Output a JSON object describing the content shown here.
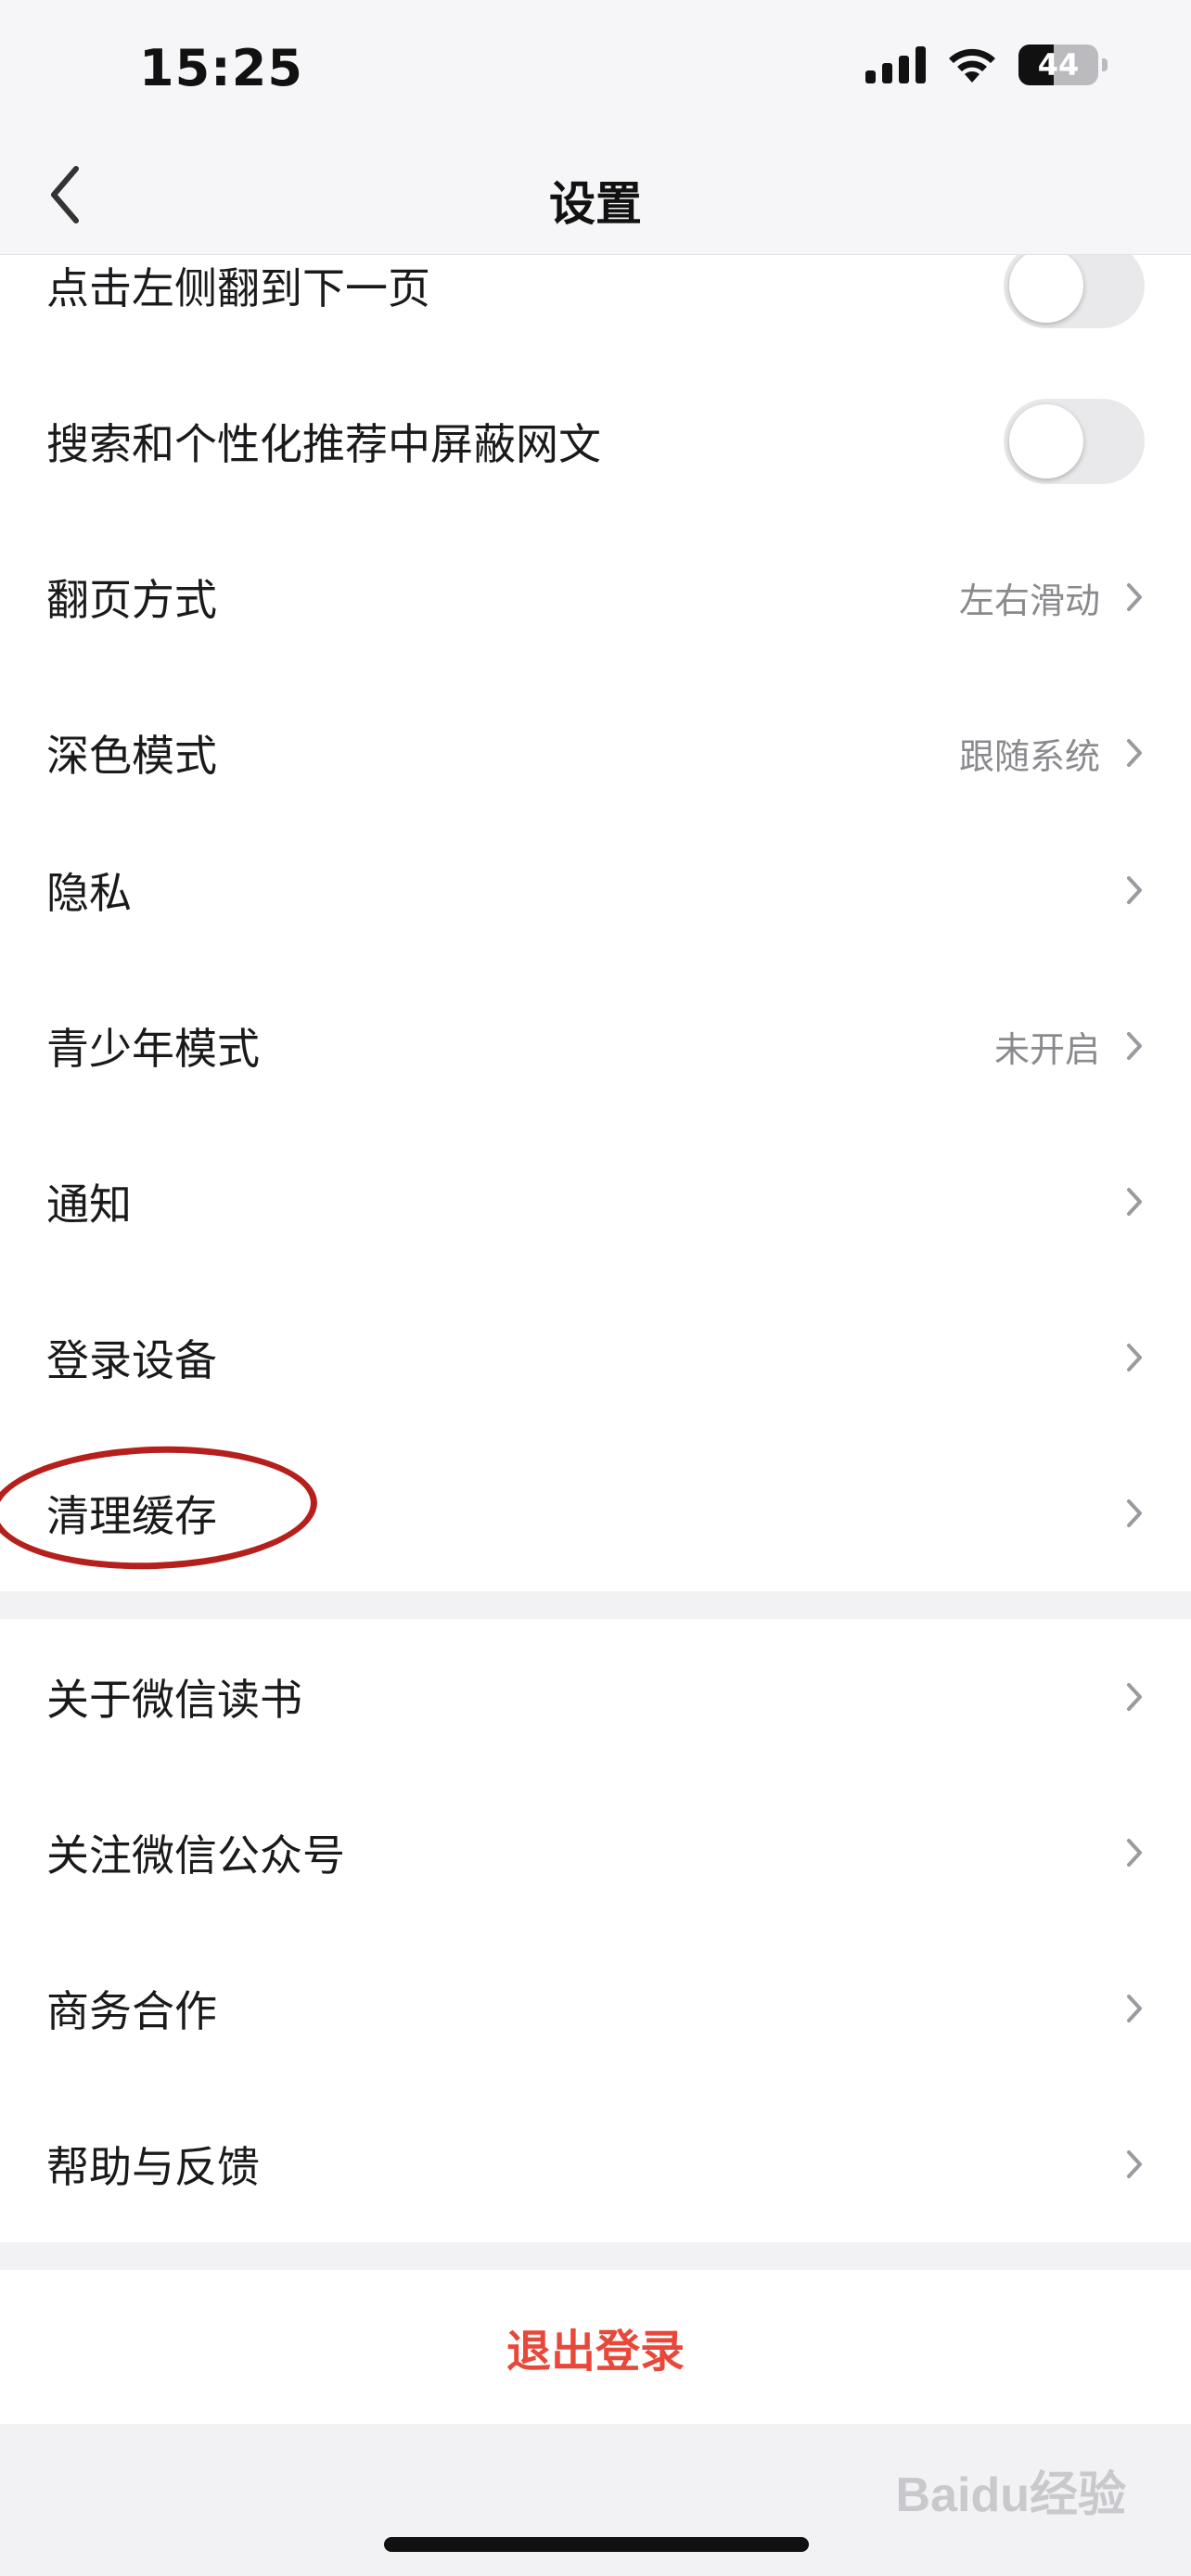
{
  "status_bar": {
    "time": "15:25",
    "battery": "44"
  },
  "nav": {
    "title": "设置"
  },
  "section1": {
    "partial_label": "点击左侧翻到下一页",
    "rows": [
      {
        "label": "搜索和个性化推荐中屏蔽网文",
        "toggle": "off"
      },
      {
        "label": "翻页方式",
        "value": "左右滑动"
      },
      {
        "label": "深色模式",
        "value": "跟随系统"
      }
    ]
  },
  "section2": {
    "rows": [
      {
        "label": "隐私"
      },
      {
        "label": "青少年模式",
        "value": "未开启"
      },
      {
        "label": "通知"
      },
      {
        "label": "登录设备"
      },
      {
        "label": "清理缓存"
      }
    ]
  },
  "section3": {
    "rows": [
      {
        "label": "关于微信读书"
      },
      {
        "label": "关注微信公众号"
      },
      {
        "label": "商务合作"
      },
      {
        "label": "帮助与反馈"
      }
    ]
  },
  "logout": {
    "label": "退出登录"
  },
  "watermark": "Baidu经验",
  "colors": {
    "accent_red": "#e8483a",
    "annotation": "#b5201c"
  }
}
